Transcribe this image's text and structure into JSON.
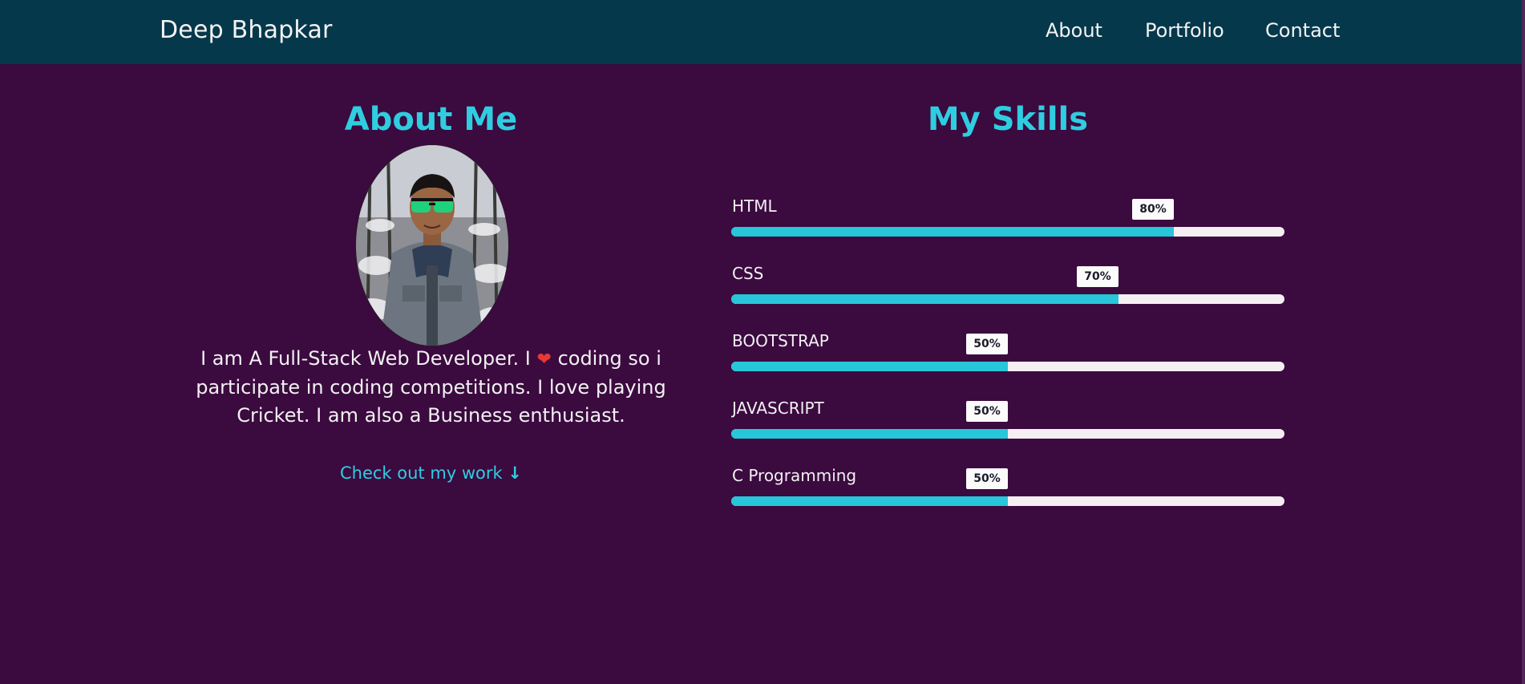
{
  "navbar": {
    "brand": "Deep Bhapkar",
    "links": [
      "About",
      "Portfolio",
      "Contact"
    ],
    "background": "#06384b"
  },
  "about": {
    "title": "About Me",
    "avatar_alt": "Profile photo of Deep Bhapkar",
    "bio_before_heart": "I am A Full-Stack Web Developer. I",
    "bio_heart": "❤",
    "bio_after_heart": "coding so i participate in coding competitions. I love playing Cricket. I am also a Business enthusiast.",
    "cta_label": "Check out my work",
    "cta_icon": "↓"
  },
  "skills": {
    "title": "My Skills",
    "items": [
      {
        "name": "HTML",
        "percent_label": "80%",
        "percent": 80
      },
      {
        "name": "CSS",
        "percent_label": "70%",
        "percent": 70
      },
      {
        "name": "BOOTSTRAP",
        "percent_label": "50%",
        "percent": 50
      },
      {
        "name": "JAVASCRIPT",
        "percent_label": "50%",
        "percent": 50
      },
      {
        "name": "C Programming",
        "percent_label": "50%",
        "percent": 50
      }
    ]
  },
  "colors": {
    "page_background": "#3b0a3f",
    "accent": "#2fcde0",
    "bar_track": "#f5eef2",
    "bar_fill": "#27c6d9"
  }
}
